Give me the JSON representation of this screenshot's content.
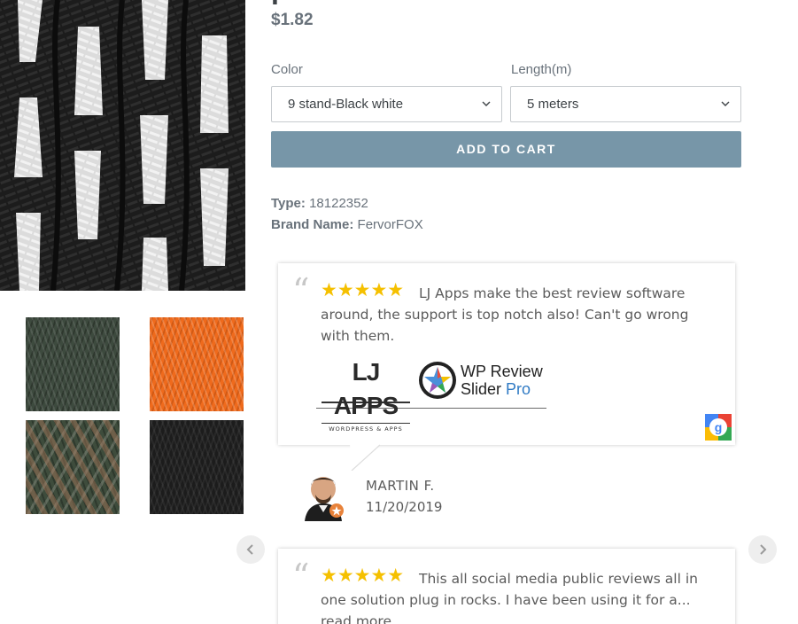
{
  "product": {
    "title_fragment": "r",
    "price": "$1.82",
    "options": [
      {
        "label": "Color",
        "value": "9 stand-Black white"
      },
      {
        "label": "Length(m)",
        "value": "5 meters"
      }
    ],
    "add_to_cart": "ADD TO CART",
    "meta": [
      {
        "key": "Type:",
        "value": "18122352"
      },
      {
        "key": "Brand Name:",
        "value": "FervorFOX"
      }
    ]
  },
  "gallery": {
    "thumbnails": [
      {
        "name": "olive-green-cord"
      },
      {
        "name": "orange-cord"
      },
      {
        "name": "camo-cord"
      },
      {
        "name": "black-cord"
      }
    ]
  },
  "reviews": [
    {
      "stars": "★★★★★",
      "text": "LJ Apps make the best review software around, the support is top notch also! Can't go wrong with them.",
      "logo_lj": "LJ APPS",
      "logo_lj_sub": "WORDPRESS & APPS",
      "logo_wp_line1": "WP Review",
      "logo_wp_line2a": "Slider",
      "logo_wp_line2b": "Pro",
      "reviewer": "MARTIN F.",
      "date": "11/20/2019"
    },
    {
      "stars": "★★★★★",
      "text": "This all social media public reviews all in one solution plug in rocks. I have been using it for a...",
      "read_more": "read more"
    }
  ],
  "colors": {
    "accent_button": "#7796a8",
    "star": "#f5c000",
    "text": "#3d4246",
    "muted": "#69727b"
  },
  "icons": {
    "select_chevron": "chevron-down-icon",
    "prev": "chevron-left-icon",
    "next": "chevron-right-icon",
    "google": "google-icon"
  }
}
